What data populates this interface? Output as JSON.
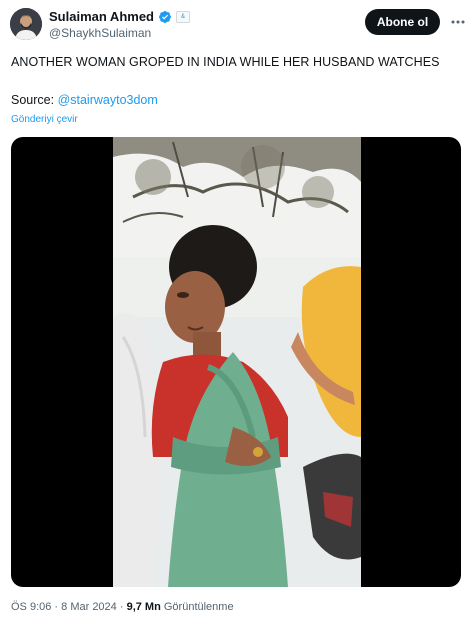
{
  "author": {
    "name": "Sulaiman Ahmed",
    "handle": "@ShaykhSulaiman",
    "verified": true,
    "verified_icon": "verified-badge-icon",
    "affiliation_icon": "affiliation-badge-icon",
    "affiliation_text": "&"
  },
  "actions": {
    "follow_label": "Abone ol",
    "more_icon": "more-options-icon"
  },
  "tweet": {
    "text": "ANOTHER WOMAN GROPED IN INDIA WHILE HER HUSBAND WATCHES",
    "source_prefix": "Source: ",
    "source_link": "@stairwayto3dom",
    "translate_label": "Gönderiyi çevir"
  },
  "media": {
    "type": "video"
  },
  "footer": {
    "time": "ÖS 9:06",
    "separator": " · ",
    "date": "8 Mar 2024",
    "separator2": " · ",
    "views_count": "9,7 Mn",
    "views_label": " Görüntülenme"
  },
  "colors": {
    "accent": "#1d9bf0",
    "text": "#0f1419",
    "secondary": "#536471",
    "button_bg": "#0f1419"
  }
}
